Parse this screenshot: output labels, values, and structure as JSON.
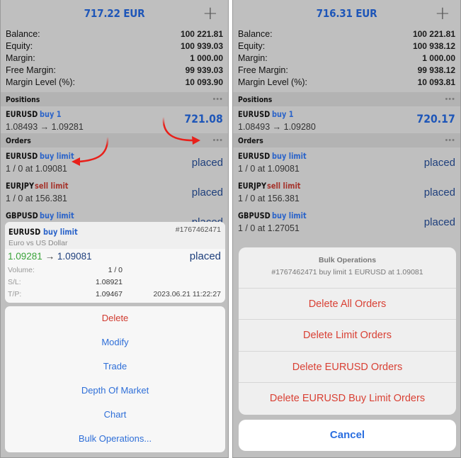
{
  "left": {
    "header": {
      "profit": "717.22 EUR",
      "add_icon": "plus-icon"
    },
    "summary": [
      {
        "label": "Balance:",
        "value": "100 221.81"
      },
      {
        "label": "Equity:",
        "value": "100 939.03"
      },
      {
        "label": "Margin:",
        "value": "1 000.00"
      },
      {
        "label": "Free Margin:",
        "value": "99 939.03"
      },
      {
        "label": "Margin Level (%):",
        "value": "10 093.90"
      }
    ],
    "positions": {
      "title": "Positions",
      "menu": "•••",
      "items": [
        {
          "symbol": "EURUSD",
          "type": "buy 1",
          "prices": "1.08493 → 1.09281",
          "profit": "721.08"
        }
      ]
    },
    "orders": {
      "title": "Orders",
      "menu": "•••",
      "items": [
        {
          "symbol": "EURUSD",
          "type": "buy limit",
          "detail": "1 / 0 at 1.09081",
          "status": "placed"
        },
        {
          "symbol": "EURJPY",
          "type": "sell limit",
          "detail": "1 / 0 at 156.381",
          "status": "placed"
        },
        {
          "symbol": "GBPUSD",
          "type": "buy limit",
          "detail": "",
          "status": "placed"
        }
      ]
    },
    "detail_card": {
      "symbol": "EURUSD",
      "type": "buy limit",
      "description": "Euro vs US Dollar",
      "ticket": "#1767462471",
      "price_from": "1.09281",
      "arrow": "→",
      "price_to": "1.09081",
      "status": "placed",
      "volume_label": "Volume:",
      "volume": "1 / 0",
      "sl_label": "S/L:",
      "sl": "1.08921",
      "tp_label": "T/P:",
      "tp": "1.09467",
      "time": "2023.06.21 11:22:27"
    },
    "actions": [
      {
        "label": "Delete",
        "destructive": true
      },
      {
        "label": "Modify"
      },
      {
        "label": "Trade"
      },
      {
        "label": "Depth Of Market"
      },
      {
        "label": "Chart"
      },
      {
        "label": "Bulk Operations..."
      }
    ]
  },
  "right": {
    "header": {
      "profit": "716.31 EUR",
      "add_icon": "plus-icon"
    },
    "summary": [
      {
        "label": "Balance:",
        "value": "100 221.81"
      },
      {
        "label": "Equity:",
        "value": "100 938.12"
      },
      {
        "label": "Margin:",
        "value": "1 000.00"
      },
      {
        "label": "Free Margin:",
        "value": "99 938.12"
      },
      {
        "label": "Margin Level (%):",
        "value": "10 093.81"
      }
    ],
    "positions": {
      "title": "Positions",
      "menu": "•••",
      "items": [
        {
          "symbol": "EURUSD",
          "type": "buy 1",
          "prices": "1.08493 → 1.09280",
          "profit": "720.17"
        }
      ]
    },
    "orders": {
      "title": "Orders",
      "menu": "•••",
      "items": [
        {
          "symbol": "EURUSD",
          "type": "buy limit",
          "detail": "1 / 0 at 1.09081",
          "status": "placed"
        },
        {
          "symbol": "EURJPY",
          "type": "sell limit",
          "detail": "1 / 0 at 156.381",
          "status": "placed"
        },
        {
          "symbol": "GBPUSD",
          "type": "buy limit",
          "detail": "1 / 0 at 1.27051",
          "status": "placed"
        }
      ]
    },
    "bulk": {
      "title": "Bulk Operations",
      "subtitle": "#1767462471 buy limit 1 EURUSD at 1.09081",
      "actions": [
        "Delete All Orders",
        "Delete Limit Orders",
        "Delete EURUSD Orders",
        "Delete EURUSD Buy Limit Orders"
      ],
      "cancel": "Cancel"
    }
  },
  "colors": {
    "accent_blue": "#1e56b8",
    "buy_blue": "#2a63c9",
    "sell_red": "#a5332b",
    "destructive_red": "#d94135",
    "price_up_green": "#3aa33a",
    "annotation_arrow": "#e8201a"
  }
}
